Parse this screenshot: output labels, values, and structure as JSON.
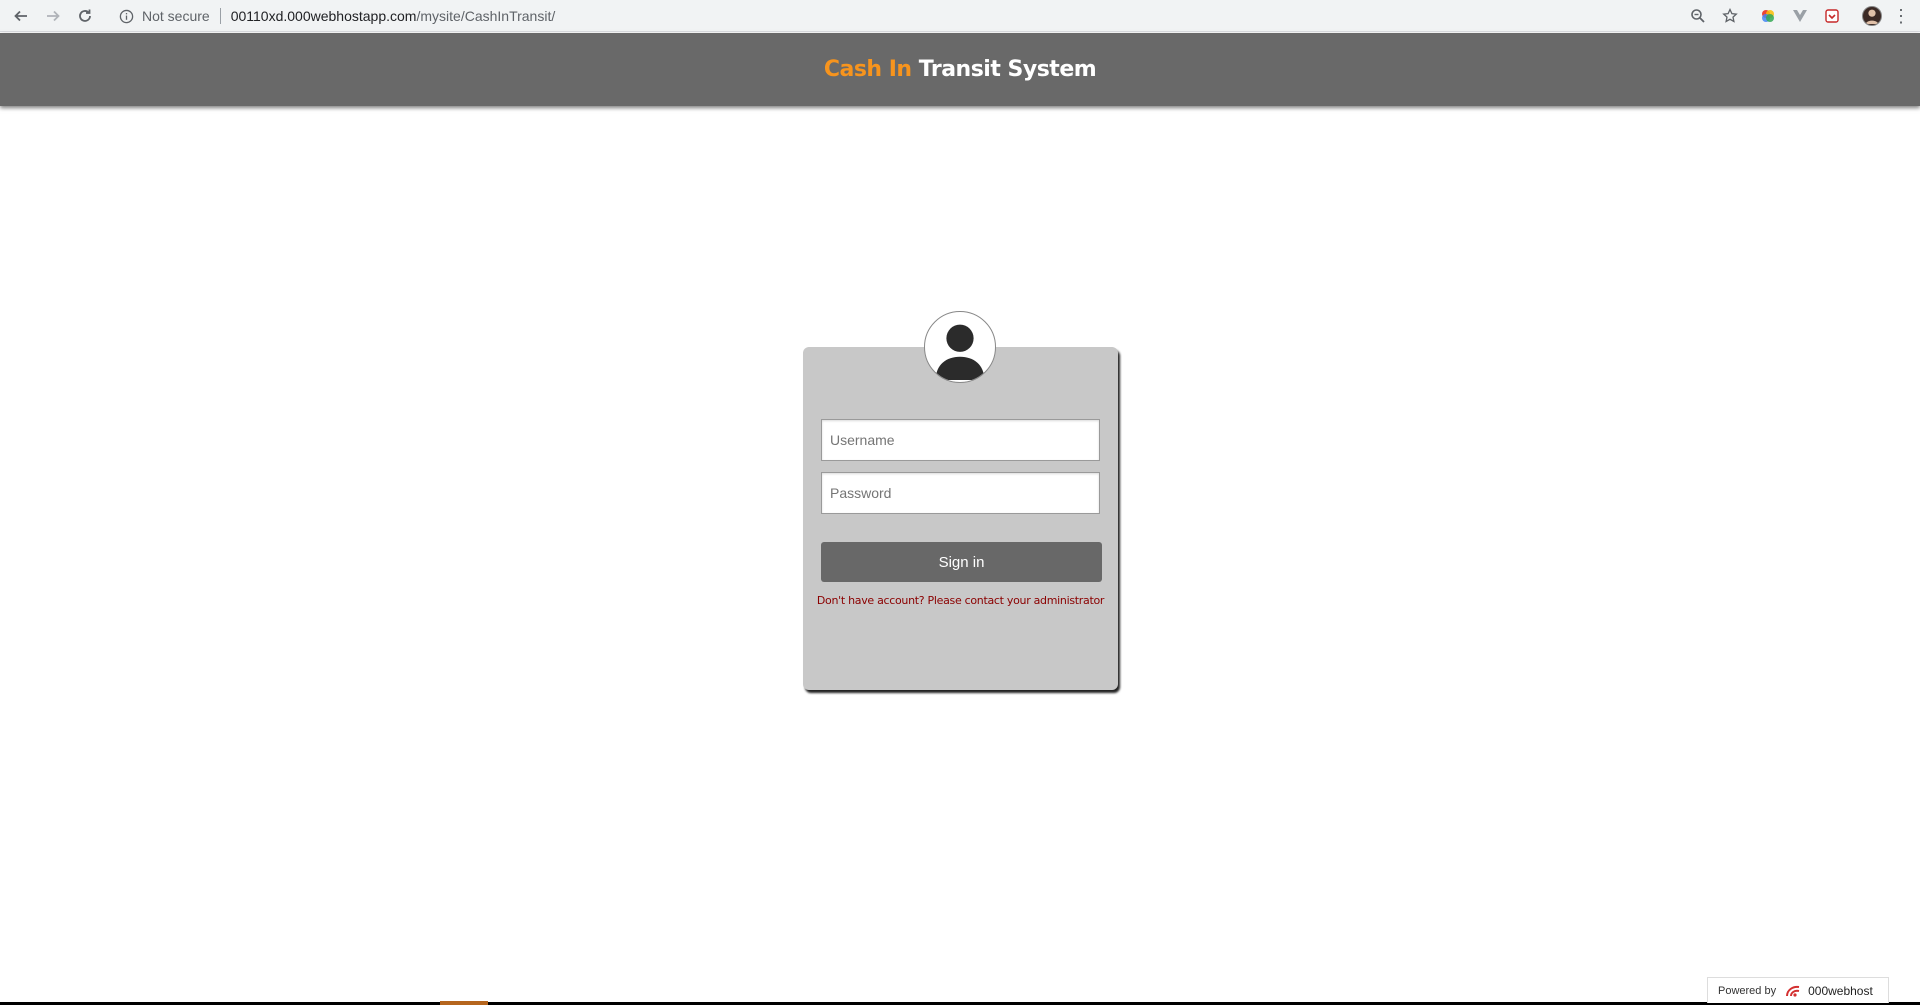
{
  "browser": {
    "security_label": "Not secure",
    "url_host": "00110xd.000webhostapp.com",
    "url_path": "/mysite/CashInTransit/"
  },
  "header": {
    "title_part1": "Cash In",
    "title_part2": "Transit System"
  },
  "login": {
    "username_placeholder": "Username",
    "password_placeholder": "Password",
    "signin_label": "Sign in",
    "note": "Don't have account? Please contact your administrator"
  },
  "footer": {
    "powered_by": "Powered by",
    "brand": "000webhost"
  },
  "colors": {
    "header_bg": "#696969",
    "accent_orange": "#f7941d",
    "card_bg": "#c8c8c8",
    "button_bg": "#686868",
    "note_text": "#8b0000"
  }
}
